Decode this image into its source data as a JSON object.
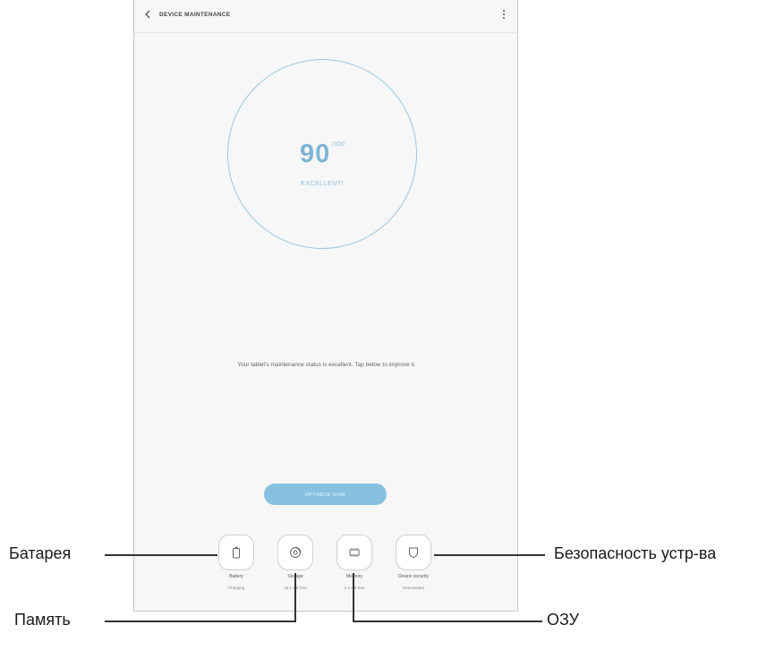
{
  "header": {
    "title": "DEVICE MAINTENANCE",
    "back_icon": "chevron-left-icon",
    "more_icon": "more-vertical-icon"
  },
  "score": {
    "value": "90",
    "max": "/100",
    "status": "EXCELLENT!"
  },
  "message": "Your tablet's maintenance status is excellent. Tap below to improve it.",
  "optimize_button": "OPTIMIZE NOW",
  "tools": [
    {
      "label": "Battery",
      "status": "Charging",
      "icon": "battery-icon"
    },
    {
      "label": "Storage",
      "status": "18.1 GB free",
      "icon": "storage-icon"
    },
    {
      "label": "Memory",
      "status": "1.3 GB free",
      "icon": "memory-chip-icon"
    },
    {
      "label": "Device security",
      "status": "Deactivated",
      "icon": "shield-icon"
    }
  ],
  "callouts": {
    "battery": "Батарея",
    "storage": "Память",
    "ram": "ОЗУ",
    "security": "Безопасность устр-ва"
  },
  "colors": {
    "accent": "#86c2e0",
    "ring": "#9cc7e0",
    "background": "#f7f7f7"
  }
}
